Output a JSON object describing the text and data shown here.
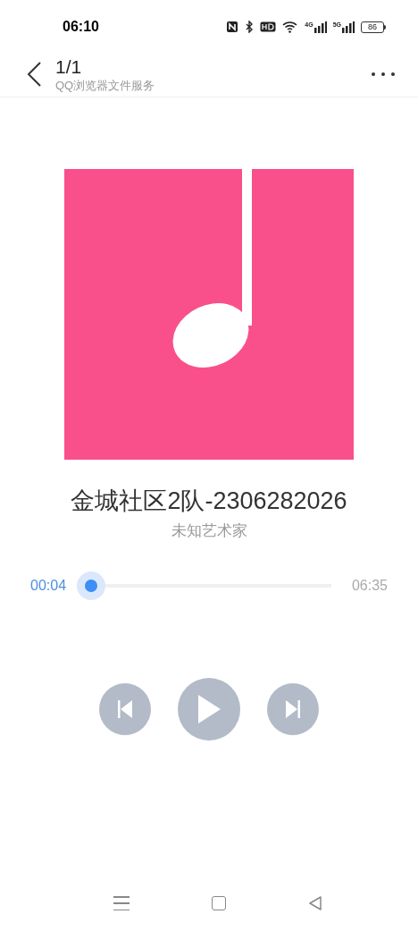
{
  "status_bar": {
    "time": "06:10",
    "signals": [
      {
        "label": "4G"
      },
      {
        "label": "5G"
      }
    ],
    "battery": "86"
  },
  "header": {
    "title": "1/1",
    "subtitle": "QQ浏览器文件服务"
  },
  "track": {
    "title": "金城社区2队-2306282026",
    "artist": "未知艺术家"
  },
  "progress": {
    "elapsed": "00:04",
    "total": "06:35",
    "level": 0.01
  },
  "player": {
    "playing": false
  }
}
